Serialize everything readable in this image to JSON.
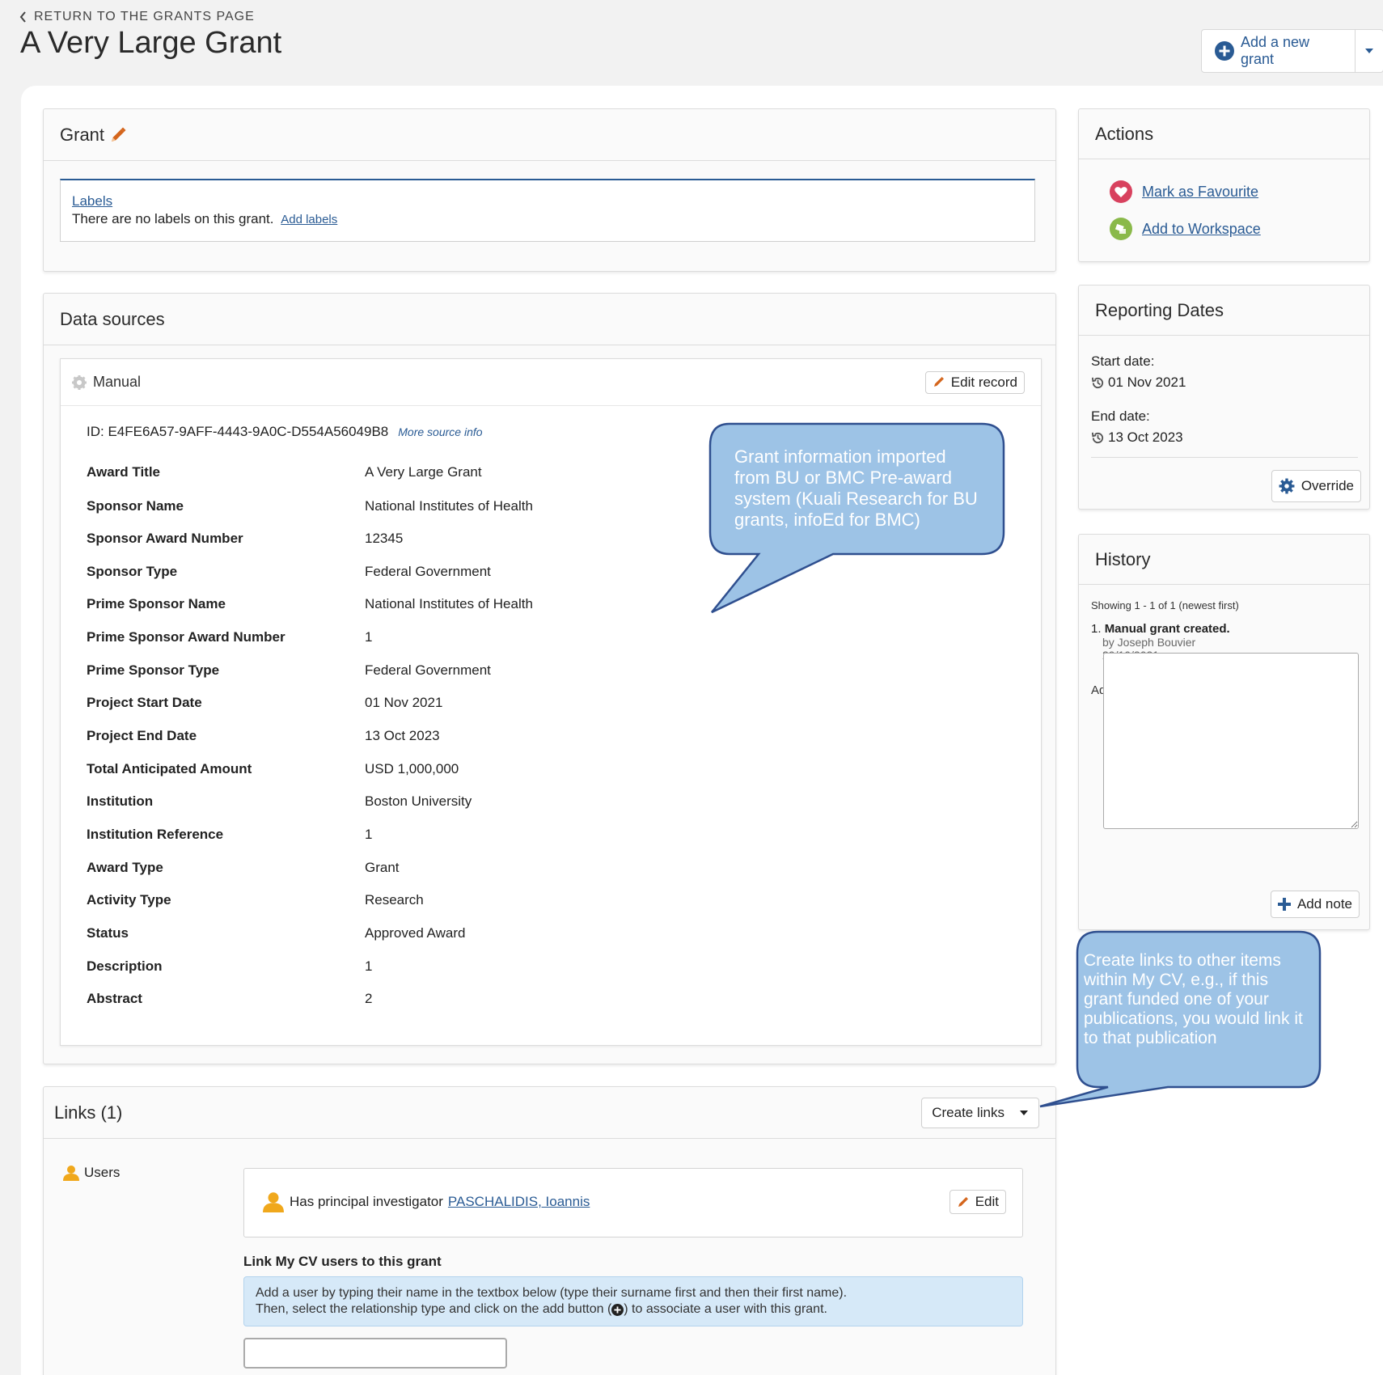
{
  "header": {
    "return_label": "RETURN TO THE GRANTS PAGE",
    "title": "A Very Large Grant",
    "add_grant_label": "Add a new grant"
  },
  "grant_panel": {
    "title": "Grant",
    "labels_link": "Labels",
    "no_labels_text": "There are no labels on this grant.",
    "add_labels_link": "Add labels"
  },
  "data_sources": {
    "title": "Data sources",
    "source_name": "Manual",
    "edit_record_label": "Edit record",
    "id_text": "ID: E4FE6A57-9AFF-4443-9A0C-D554A56049B8",
    "more_info_link": "More source info",
    "fields": [
      {
        "label": "Award Title",
        "value": "A Very Large Grant"
      },
      {
        "label": "Sponsor Name",
        "value": "National Institutes of Health"
      },
      {
        "label": "Sponsor Award Number",
        "value": "12345"
      },
      {
        "label": "Sponsor Type",
        "value": "Federal Government"
      },
      {
        "label": "Prime Sponsor Name",
        "value": "National Institutes of Health"
      },
      {
        "label": "Prime Sponsor Award Number",
        "value": "1"
      },
      {
        "label": "Prime Sponsor Type",
        "value": "Federal Government"
      },
      {
        "label": "Project Start Date",
        "value": "01 Nov 2021"
      },
      {
        "label": "Project End Date",
        "value": "13 Oct 2023"
      },
      {
        "label": "Total Anticipated Amount",
        "value": "USD 1,000,000"
      },
      {
        "label": "Institution",
        "value": "Boston University"
      },
      {
        "label": "Institution Reference",
        "value": "1"
      },
      {
        "label": "Award Type",
        "value": "Grant"
      },
      {
        "label": "Activity Type",
        "value": "Research"
      },
      {
        "label": "Status",
        "value": "Approved Award"
      },
      {
        "label": "Description",
        "value": "1"
      },
      {
        "label": "Abstract",
        "value": "2"
      }
    ]
  },
  "callouts": {
    "import_note": "Grant information imported from BU or BMC Pre-award system (Kuali Research for BU grants, infoEd for BMC)",
    "links_note": "Create links to other items within My CV, e.g., if this grant funded one of your publications, you would link it to that publication"
  },
  "links_panel": {
    "title": "Links (1)",
    "create_links_label": "Create links",
    "users_label": "Users",
    "relationship_text": "Has principal investigator",
    "person_name": "PASCHALIDIS, Ioannis",
    "edit_label": "Edit",
    "link_users_heading": "Link My CV users to this grant",
    "info_line1": "Add a user by typing their name in the textbox below (type their surname first and then their first name).",
    "info_line2_a": "Then, select the relationship type and click on the add button (",
    "info_line2_b": ") to associate a user with this grant."
  },
  "actions_panel": {
    "title": "Actions",
    "favourite_label": "Mark as Favourite",
    "workspace_label": "Add to Workspace"
  },
  "reporting_dates": {
    "title": "Reporting Dates",
    "start_label": "Start date:",
    "start_value": "01 Nov 2021",
    "end_label": "End date:",
    "end_value": "13 Oct 2023",
    "override_label": "Override"
  },
  "history": {
    "title": "History",
    "showing_text": "Showing 1 - 1 of 1 (newest first)",
    "item_number": "1.",
    "item_title": "Manual grant created.",
    "item_by": "by Joseph Bouvier",
    "item_date": "29/10/2021",
    "note_label": "Add a note:",
    "add_note_label": "Add note"
  },
  "colors": {
    "link_blue": "#2a5b94",
    "callout_fill": "#9dc3e6",
    "callout_border": "#2f4f8f",
    "pencil_orange": "#d4651c",
    "heart_red": "#d8415e",
    "workspace_green": "#8ab94a",
    "user_orange": "#f0a81c"
  }
}
